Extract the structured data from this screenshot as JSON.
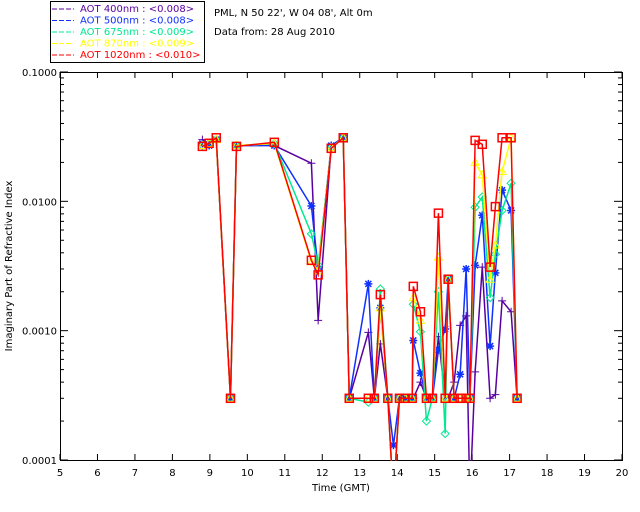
{
  "header": {
    "site": "PML, N 50 22', W 04 08', Alt 0m",
    "date": "Data from: 28 Aug 2010"
  },
  "chart_data": {
    "type": "line",
    "xlabel": "Time (GMT)",
    "ylabel": "Imaginary Part of Refractive Index",
    "xlim": [
      5,
      20
    ],
    "ylim": [
      0.0001,
      0.1
    ],
    "yscale": "log",
    "x_ticks": [
      "5",
      "6",
      "7",
      "8",
      "9",
      "10",
      "11",
      "12",
      "13",
      "14",
      "15",
      "16",
      "17",
      "18",
      "19",
      "20"
    ],
    "y_ticks": [
      "0.0001",
      "0.0010",
      "0.0100",
      "0.1000"
    ],
    "grid": false,
    "legend_position": "top-left, above plot",
    "x": [
      8.8,
      8.98,
      9.17,
      9.55,
      9.71,
      10.72,
      11.71,
      11.89,
      12.24,
      12.56,
      12.72,
      13.23,
      13.39,
      13.55,
      13.75,
      13.9,
      14.06,
      14.21,
      14.4,
      14.43,
      14.62,
      14.78,
      14.94,
      15.1,
      15.28,
      15.36,
      15.52,
      15.68,
      15.84,
      15.94,
      16.08,
      16.27,
      16.48,
      16.62,
      16.8,
      17.04,
      17.2
    ],
    "series": [
      {
        "name": "AOT  400nm : <0.008>",
        "color": "#5a00a0",
        "marker": "plus",
        "values": [
          0.03,
          0.028,
          0.03,
          0.0003,
          0.027,
          0.027,
          0.0197,
          0.0012,
          0.027,
          0.031,
          0.0003,
          0.00097,
          0.0003,
          0.00079,
          0.0003,
          5e-05,
          0.0003,
          0.0003,
          0.0003,
          0.0003,
          0.0004,
          0.0003,
          0.0003,
          0.0009,
          0.0003,
          0.0003,
          0.0004,
          0.0011,
          0.0013,
          5e-05,
          0.00048,
          0.0031,
          0.0003,
          0.00032,
          0.0017,
          0.0014,
          0.0003
        ]
      },
      {
        "name": "AOT  500nm : <0.008>",
        "color": "#1030ff",
        "marker": "star",
        "values": [
          0.028,
          0.027,
          0.03,
          0.0003,
          0.027,
          0.027,
          0.0092,
          0.003,
          0.027,
          0.031,
          0.0003,
          0.0023,
          0.0003,
          0.0015,
          0.0003,
          0.00013,
          0.0003,
          0.0003,
          0.0003,
          0.00084,
          0.00047,
          0.0003,
          0.0003,
          0.00071,
          0.00103,
          0.0025,
          0.0003,
          0.00046,
          0.003,
          0.0003,
          0.0032,
          0.0078,
          0.00076,
          0.0028,
          0.0122,
          0.0085,
          0.0003
        ]
      },
      {
        "name": "AOT  675nm : <0.009>",
        "color": "#00e890",
        "marker": "diamond",
        "values": [
          0.027,
          0.028,
          0.03,
          0.0003,
          0.027,
          0.028,
          0.0056,
          0.0032,
          0.026,
          0.031,
          0.0003,
          0.00028,
          0.0003,
          0.0021,
          0.0003,
          5e-05,
          0.0003,
          0.0003,
          0.0003,
          0.0016,
          0.00098,
          0.0002,
          0.0003,
          0.002,
          0.00016,
          0.0025,
          0.0003,
          0.0003,
          0.0003,
          0.0003,
          0.009,
          0.0108,
          0.0018,
          0.0039,
          0.0085,
          0.0138,
          0.0003
        ]
      },
      {
        "name": "AOT  870nm : <0.009>",
        "color": "#ffff00",
        "marker": "triangle",
        "values": [
          0.027,
          0.028,
          0.03,
          0.0003,
          0.027,
          0.028,
          0.0034,
          0.0029,
          0.026,
          0.031,
          0.0003,
          0.0003,
          0.0003,
          0.0015,
          0.0003,
          5e-05,
          0.0003,
          0.0003,
          0.0003,
          0.0018,
          0.0012,
          0.0003,
          0.0003,
          0.0037,
          0.0003,
          0.0025,
          0.0003,
          0.0003,
          0.0003,
          0.0003,
          0.02,
          0.016,
          0.0025,
          0.0046,
          0.017,
          0.031,
          0.0003
        ]
      },
      {
        "name": "AOT 1020nm : <0.010>",
        "color": "#ff0000",
        "marker": "square",
        "values": [
          0.0266,
          0.0281,
          0.031,
          0.0003,
          0.0266,
          0.0286,
          0.0035,
          0.0027,
          0.0257,
          0.031,
          0.0003,
          0.0003,
          0.0003,
          0.0019,
          0.0003,
          5e-05,
          0.0003,
          0.0003,
          0.0003,
          0.0022,
          0.0014,
          0.0003,
          0.0003,
          0.0081,
          0.0003,
          0.0025,
          0.0003,
          0.0003,
          0.0003,
          0.0003,
          0.0296,
          0.0276,
          0.0031,
          0.0091,
          0.031,
          0.031,
          0.0003
        ]
      }
    ]
  }
}
